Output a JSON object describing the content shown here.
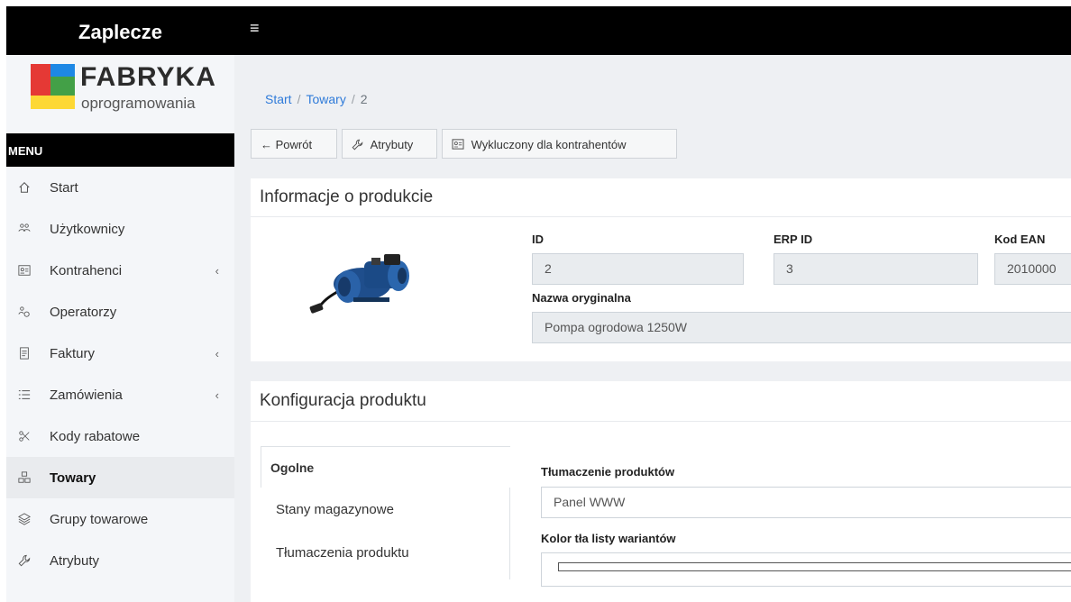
{
  "sidebar": {
    "brand": "Zaplecze",
    "logo": {
      "line1": "FABRYKA",
      "line2": "oprogramowania",
      "colors": [
        "#e53935",
        "#1e88e5",
        "#43a047",
        "#fdd835"
      ]
    },
    "menu_header": "MENU",
    "items": [
      {
        "label": "Start",
        "icon": "home-icon",
        "chevron": ""
      },
      {
        "label": "Użytkownicy",
        "icon": "users-icon",
        "chevron": ""
      },
      {
        "label": "Kontrahenci",
        "icon": "id-card-icon",
        "chevron": "‹"
      },
      {
        "label": "Operatorzy",
        "icon": "operators-icon",
        "chevron": ""
      },
      {
        "label": "Faktury",
        "icon": "invoice-icon",
        "chevron": "‹"
      },
      {
        "label": "Zamówienia",
        "icon": "list-icon",
        "chevron": "‹"
      },
      {
        "label": "Kody rabatowe",
        "icon": "scissors-icon",
        "chevron": ""
      },
      {
        "label": "Towary",
        "icon": "boxes-icon",
        "chevron": "",
        "active": true
      },
      {
        "label": "Grupy towarowe",
        "icon": "layers-icon",
        "chevron": ""
      },
      {
        "label": "Atrybuty",
        "icon": "wrench-icon",
        "chevron": ""
      }
    ]
  },
  "topbar": {
    "menu_icon": "≡"
  },
  "breadcrumb": {
    "start": "Start",
    "sep": "/",
    "towary": "Towary",
    "current": "2"
  },
  "toolbar": {
    "back": "← Powrót",
    "attributes": "Atrybuty",
    "excluded": "Wykluczony dla kontrahentów"
  },
  "info_card": {
    "title": "Informacje o produkcie",
    "id_label": "ID",
    "id_value": "2",
    "erp_label": "ERP ID",
    "erp_value": "3",
    "ean_label": "Kod EAN",
    "ean_value": "2010000",
    "name_label": "Nazwa oryginalna",
    "name_value": "Pompa ogrodowa 1250W"
  },
  "config_card": {
    "title": "Konfiguracja produktu",
    "tabs": [
      "Ogolne",
      "Stany magazynowe",
      "Tłumaczenia produktu"
    ],
    "translation_label": "Tłumaczenie produktów",
    "translation_value": "Panel WWW",
    "color_label": "Kolor tła listy wariantów"
  },
  "colors": {
    "accent": "#2f7bd9",
    "header": "#000000",
    "sidebar_bg": "#f4f6f9"
  }
}
